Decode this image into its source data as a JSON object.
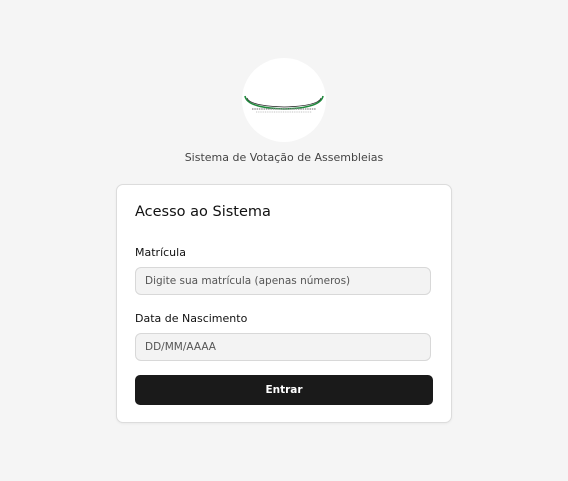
{
  "header": {
    "logo_icon": "assembly-logo-icon",
    "subtitle": "Sistema de Votação de Assembleias"
  },
  "login_card": {
    "title": "Acesso ao Sistema",
    "matricula": {
      "label": "Matrícula",
      "value": "",
      "placeholder": "Digite sua matrícula (apenas números)"
    },
    "nascimento": {
      "label": "Data de Nascimento",
      "value": "",
      "placeholder": "DD/MM/AAAA"
    },
    "submit_label": "Entrar"
  },
  "colors": {
    "background": "#f5f5f5",
    "card": "#ffffff",
    "button": "#1a1a1a",
    "logo_green": "#1e8a3c"
  }
}
